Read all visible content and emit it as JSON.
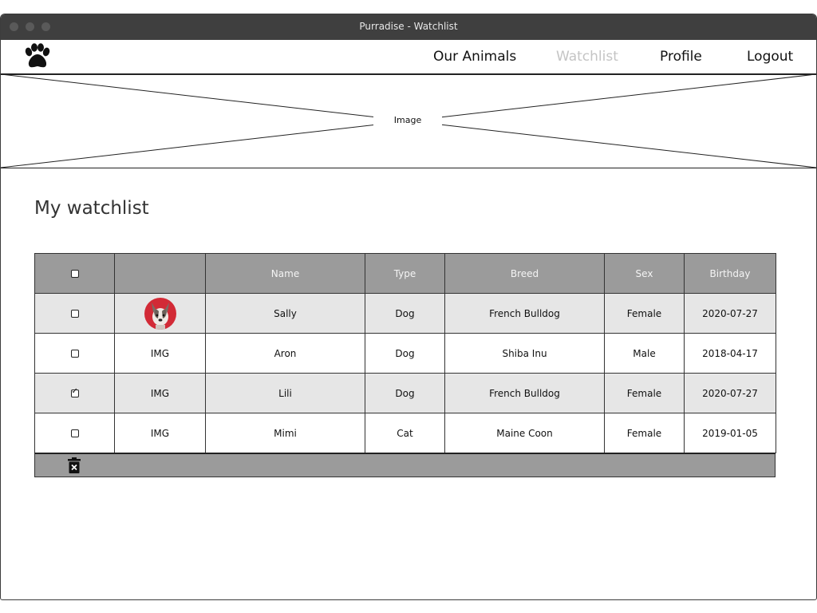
{
  "window": {
    "title": "Purradise - Watchlist"
  },
  "nav": {
    "logo_icon": "paw-icon",
    "links": [
      {
        "label": "Our Animals",
        "active": false
      },
      {
        "label": "Watchlist",
        "active": true
      },
      {
        "label": "Profile",
        "active": false
      },
      {
        "label": "Logout",
        "active": false
      }
    ],
    "active_color": "#c4c4c4"
  },
  "hero": {
    "label": "Image"
  },
  "page": {
    "heading": "My watchlist"
  },
  "table": {
    "columns": [
      "",
      "",
      "Name",
      "Type",
      "Breed",
      "Sex",
      "Birthday"
    ],
    "select_all_checked": false,
    "rows": [
      {
        "checked": false,
        "image": "photo",
        "name": "Sally",
        "type": "Dog",
        "breed": "French Bulldog",
        "sex": "Female",
        "birthday": "2020-07-27"
      },
      {
        "checked": false,
        "image": "IMG",
        "name": "Aron",
        "type": "Dog",
        "breed": "Shiba Inu",
        "sex": "Male",
        "birthday": "2018-04-17"
      },
      {
        "checked": true,
        "image": "IMG",
        "name": "Lili",
        "type": "Dog",
        "breed": "French Bulldog",
        "sex": "Female",
        "birthday": "2020-07-27"
      },
      {
        "checked": false,
        "image": "IMG",
        "name": "Mimi",
        "type": "Cat",
        "breed": "Maine Coon",
        "sex": "Female",
        "birthday": "2019-01-05"
      }
    ],
    "footer": {
      "delete_icon": "trash-icon"
    }
  },
  "colors": {
    "header_bg": "#9b9b9b",
    "row_shade": "#e6e6e6",
    "avatar_bg": "#d22a36",
    "titlebar": "#3f3f3f"
  }
}
